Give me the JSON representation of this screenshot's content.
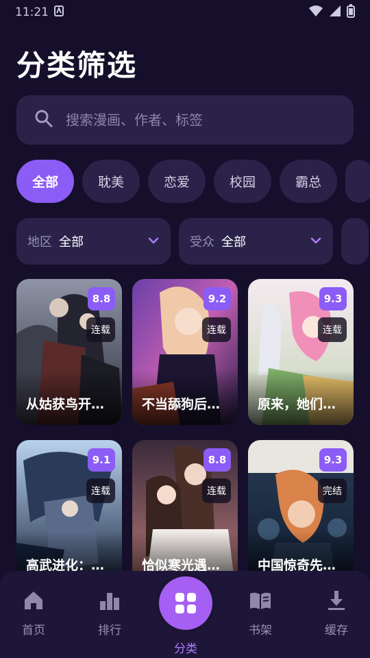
{
  "status_bar": {
    "time": "11:21"
  },
  "header": {
    "title": "分类筛选"
  },
  "search": {
    "placeholder": "搜索漫画、作者、标签"
  },
  "categories": [
    {
      "label": "全部",
      "active": true
    },
    {
      "label": "耽美",
      "active": false
    },
    {
      "label": "恋爱",
      "active": false
    },
    {
      "label": "校园",
      "active": false
    },
    {
      "label": "霸总",
      "active": false
    }
  ],
  "filters": [
    {
      "label": "地区",
      "value": "全部"
    },
    {
      "label": "受众",
      "value": "全部"
    }
  ],
  "comics": [
    {
      "title": "从姑获鸟开…",
      "score": "8.8",
      "status": "连载"
    },
    {
      "title": "不当舔狗后…",
      "score": "9.2",
      "status": "连载"
    },
    {
      "title": "原来，她们…",
      "score": "9.3",
      "status": "连载"
    },
    {
      "title": "高武进化：…",
      "score": "9.1",
      "status": "连载"
    },
    {
      "title": "恰似寒光遇…",
      "score": "8.8",
      "status": "连载"
    },
    {
      "title": "中国惊奇先…",
      "score": "9.3",
      "status": "完结"
    }
  ],
  "bottom_nav": {
    "items": [
      {
        "label": "首页",
        "icon": "home-icon"
      },
      {
        "label": "排行",
        "icon": "bar-chart-icon"
      },
      {
        "label": "分类",
        "icon": "grid-icon",
        "active": true
      },
      {
        "label": "书架",
        "icon": "book-icon"
      },
      {
        "label": "缓存",
        "icon": "download-icon"
      }
    ]
  },
  "colors": {
    "background": "#160f2b",
    "surface": "#2a2248",
    "accent": "#8b5cf6",
    "nav_active": "#a560f3"
  }
}
